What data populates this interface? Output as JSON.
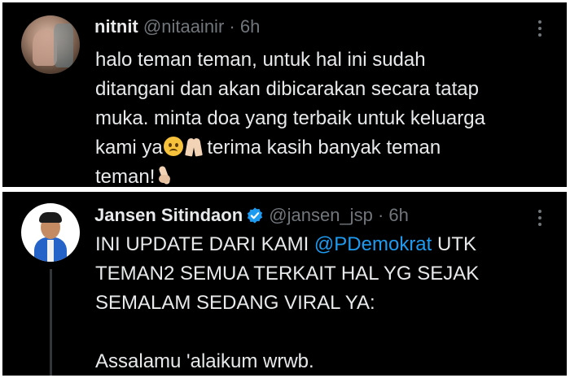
{
  "tweets": [
    {
      "name": "nitnit",
      "handle": "@nitaainir",
      "separator": "·",
      "time": "6h",
      "lines": [
        "halo teman teman, untuk hal ini sudah",
        "ditangani dan akan dibicarakan secara tatap",
        "muka. minta doa yang terbaik untuk keluarga"
      ],
      "line4_a": "kami ya",
      "line4_b": " terima kasih banyak teman",
      "line5": "teman!",
      "emojis": [
        "frowning-face",
        "folded-hands",
        "crossed-fingers"
      ]
    },
    {
      "name": "Jansen Sitindaon",
      "handle": "@jansen_jsp",
      "separator": "·",
      "time": "6h",
      "verified": true,
      "line1_a": "INI UPDATE DARI KAMI ",
      "line1_mention": "@PDemokrat",
      "line1_b": " UTK",
      "line2": "TEMAN2 SEMUA TERKAIT HAL YG SEJAK",
      "line3": "SEMALAM SEDANG VIRAL YA:",
      "line5": "Assalamu 'alaikum wrwb."
    }
  ],
  "colors": {
    "background": "#000000",
    "text": "#e7e9ea",
    "muted": "#71767b",
    "link": "#1d9bf0",
    "verified": "#1d9bf0"
  }
}
